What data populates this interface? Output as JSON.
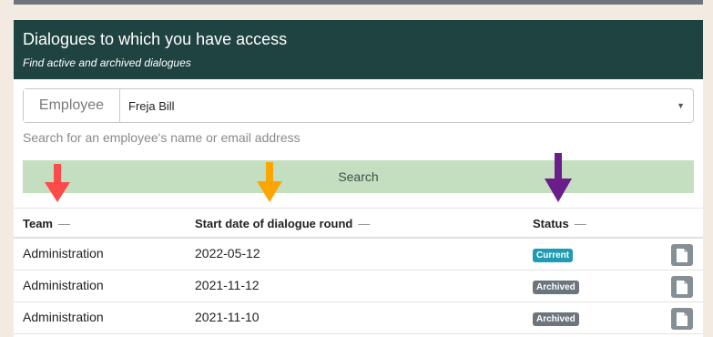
{
  "panel": {
    "title": "Dialogues to which you have access",
    "subtitle": "Find active and archived dialogues"
  },
  "employee": {
    "label": "Employee",
    "value": "Freja Bill",
    "help": "Search for an employee's name or email address"
  },
  "search": {
    "label": "Search"
  },
  "table": {
    "columns": [
      {
        "label": "Team",
        "sort": "—"
      },
      {
        "label": "Start date of dialogue round",
        "sort": "—"
      },
      {
        "label": "Status",
        "sort": "—"
      }
    ],
    "rows": [
      {
        "team": "Administration",
        "start": "2022-05-12",
        "status": "Current"
      },
      {
        "team": "Administration",
        "start": "2021-11-12",
        "status": "Archived"
      },
      {
        "team": "Administration",
        "start": "2021-11-10",
        "status": "Archived"
      }
    ]
  },
  "arrows": [
    {
      "color": "#ff4a4a"
    },
    {
      "color": "#ffa500"
    },
    {
      "color": "#6b1d8a"
    }
  ],
  "colors": {
    "header_bg": "#1f4340",
    "search_bg": "#c3dfc0",
    "badge_current": "#1f9bb3",
    "badge_archived": "#6c757d"
  }
}
